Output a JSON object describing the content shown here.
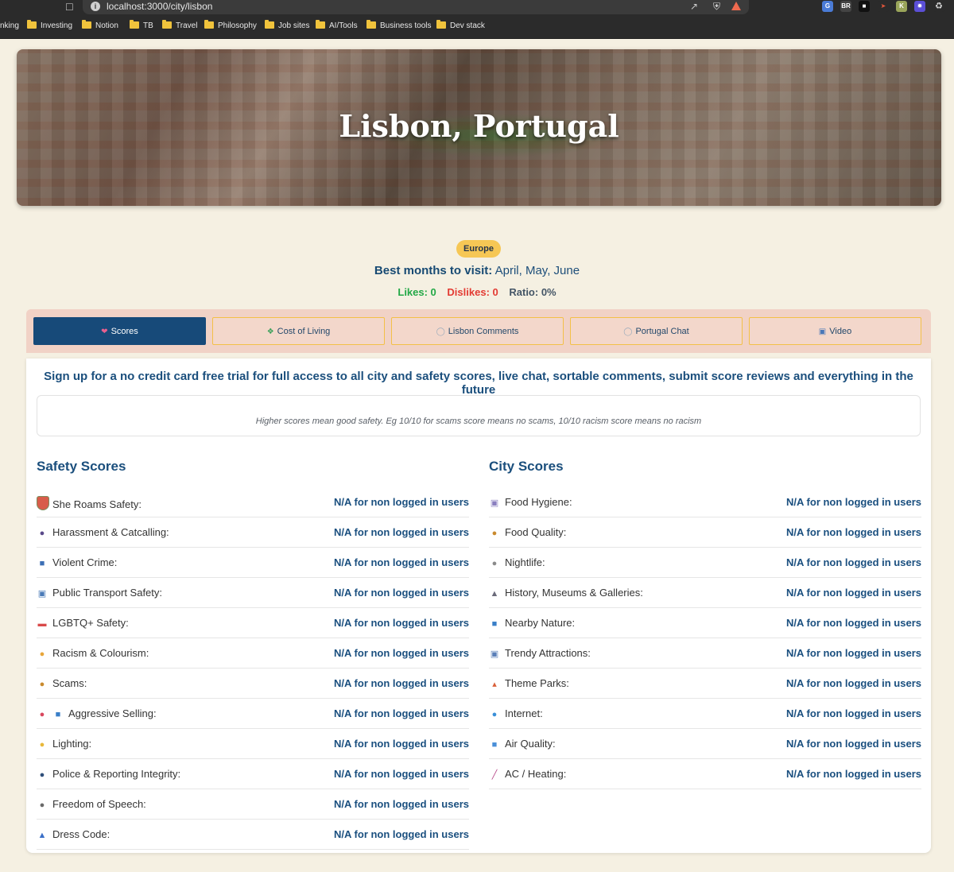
{
  "browser": {
    "url": "localhost:3000/city/lisbon",
    "bookmarks": [
      "nking",
      "Investing",
      "Notion",
      "TB",
      "Travel",
      "Philosophy",
      "Job sites",
      "AI/Tools",
      "Business tools",
      "Dev stack"
    ]
  },
  "hero": {
    "title": "Lisbon, Portugal"
  },
  "meta": {
    "region": "Europe",
    "best_label": "Best months to visit:",
    "best_months": "April, May, June",
    "likes": "Likes: 0",
    "dislikes": "Dislikes: 0",
    "ratio": "Ratio: 0%"
  },
  "tabs": [
    {
      "label": "Scores",
      "icon": "hearts-icon"
    },
    {
      "label": "Cost of Living",
      "icon": "money-icon"
    },
    {
      "label": "Lisbon Comments",
      "icon": "speech-bubble-icon"
    },
    {
      "label": "Portugal Chat",
      "icon": "chat-icon"
    },
    {
      "label": "Video",
      "icon": "tram-icon"
    }
  ],
  "signup_text": "Sign up for a no credit card free trial for full access to all city and safety scores, live chat, sortable comments, submit score reviews and everything in the future",
  "scores_note": "Higher scores mean good safety. Eg 10/10 for scams score means no scams, 10/10 racism score means no racism",
  "safety": {
    "title": "Safety Scores",
    "rows": [
      {
        "label": "She Roams Safety:",
        "value": "N/A for non logged in users",
        "icon": "shield-icon"
      },
      {
        "label": "Harassment & Catcalling:",
        "value": "N/A for non logged in users",
        "icon": "speaking-head-icon"
      },
      {
        "label": "Violent Crime:",
        "value": "N/A for non logged in users",
        "icon": "police-car-icon"
      },
      {
        "label": "Public Transport Safety:",
        "value": "N/A for non logged in users",
        "icon": "train-icon"
      },
      {
        "label": "LGBTQ+ Safety:",
        "value": "N/A for non logged in users",
        "icon": "rainbow-flag-icon"
      },
      {
        "label": "Racism & Colourism:",
        "value": "N/A for non logged in users",
        "icon": "raised-fist-icon"
      },
      {
        "label": "Scams:",
        "value": "N/A for non logged in users",
        "icon": "money-bag-icon"
      },
      {
        "label": "Aggressive Selling:",
        "value": "N/A for non logged in users",
        "icon": "megaphone-shopping-icon"
      },
      {
        "label": "Lighting:",
        "value": "N/A for non logged in users",
        "icon": "light-bulb-icon"
      },
      {
        "label": "Police & Reporting Integrity:",
        "value": "N/A for non logged in users",
        "icon": "police-officer-icon"
      },
      {
        "label": "Freedom of Speech:",
        "value": "N/A for non logged in users",
        "icon": "microphone-icon"
      },
      {
        "label": "Dress Code:",
        "value": "N/A for non logged in users",
        "icon": "dress-icon"
      }
    ]
  },
  "city": {
    "title": "City Scores",
    "rows": [
      {
        "label": "Food Hygiene:",
        "value": "N/A for non logged in users",
        "icon": "plate-icon"
      },
      {
        "label": "Food Quality:",
        "value": "N/A for non logged in users",
        "icon": "burger-icon"
      },
      {
        "label": "Nightlife:",
        "value": "N/A for non logged in users",
        "icon": "disco-ball-icon"
      },
      {
        "label": "History, Museums & Galleries:",
        "value": "N/A for non logged in users",
        "icon": "museum-icon"
      },
      {
        "label": "Nearby Nature:",
        "value": "N/A for non logged in users",
        "icon": "landscape-icon"
      },
      {
        "label": "Trendy Attractions:",
        "value": "N/A for non logged in users",
        "icon": "trend-chart-icon"
      },
      {
        "label": "Theme Parks:",
        "value": "N/A for non logged in users",
        "icon": "roller-coaster-icon"
      },
      {
        "label": "Internet:",
        "value": "N/A for non logged in users",
        "icon": "globe-icon"
      },
      {
        "label": "Air Quality:",
        "value": "N/A for non logged in users",
        "icon": "air-icon"
      },
      {
        "label": "AC / Heating:",
        "value": "N/A for non logged in users",
        "icon": "thermometer-icon"
      }
    ]
  },
  "colors": {
    "brand_blue": "#174a79",
    "badge_yellow": "#f6c755",
    "page_bg": "#f5f0e2",
    "likes_green": "#22a846",
    "dislikes_red": "#e33b33"
  }
}
